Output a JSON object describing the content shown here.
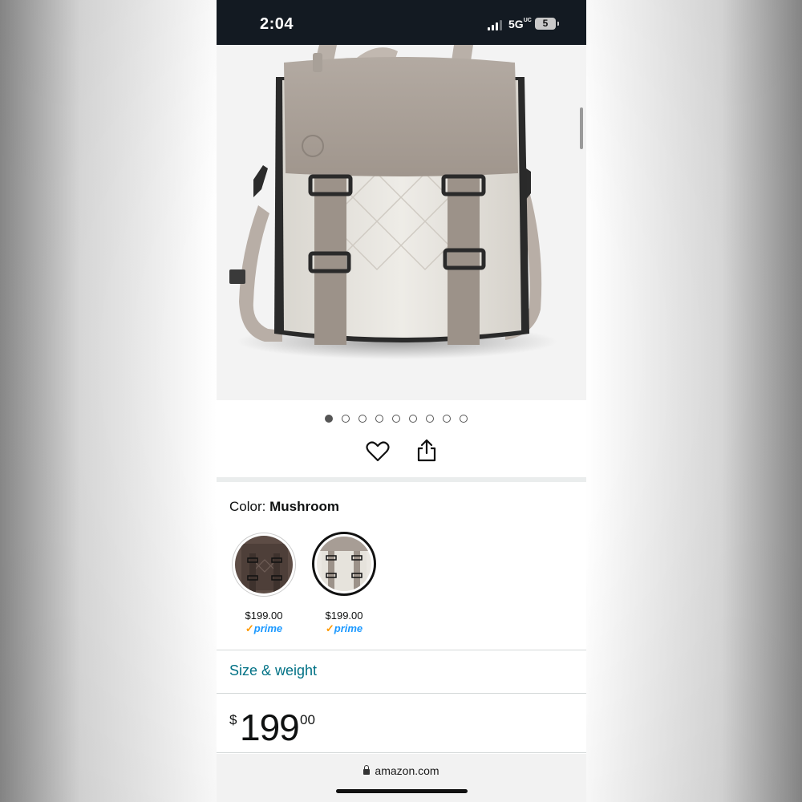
{
  "status_bar": {
    "time": "2:04",
    "network": "5G",
    "network_sup": "UC",
    "battery": "5"
  },
  "image_carousel": {
    "total_images": 9,
    "active_index": 1
  },
  "actions": {
    "favorite_icon": "heart-icon",
    "share_icon": "share-icon"
  },
  "color": {
    "label": "Color:",
    "selected": "Mushroom"
  },
  "swatches": [
    {
      "price": "$199.00",
      "prime_label": "prime",
      "color": "#5a4a44",
      "selected": false
    },
    {
      "price": "$199.00",
      "prime_label": "prime",
      "color": "#a89f97",
      "selected": true
    }
  ],
  "size_weight_link": "Size & weight",
  "price": {
    "symbol": "$",
    "whole": "199",
    "fraction": "00"
  },
  "browser": {
    "url": "amazon.com"
  },
  "colors": {
    "status_bg": "#131a22",
    "link": "#007185",
    "prime_blue": "#1a98ff",
    "prime_check": "#ff9900",
    "mushroom": "#a89f97",
    "cream": "#e6e3dc"
  }
}
